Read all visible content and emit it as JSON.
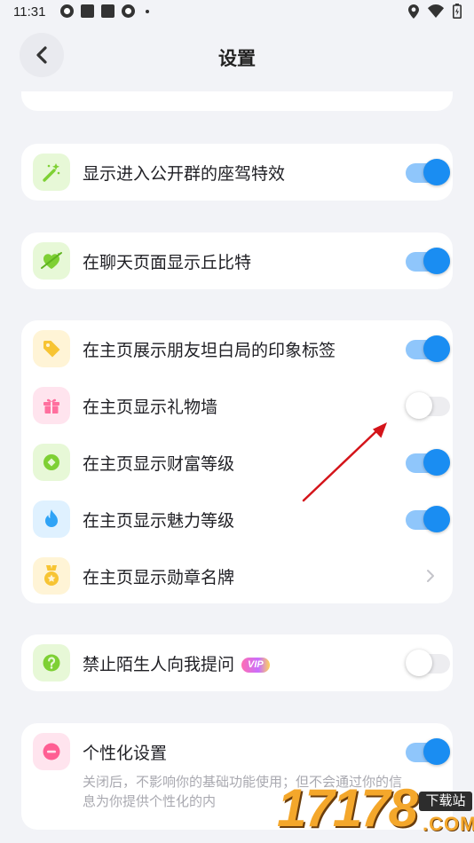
{
  "status_bar": {
    "time": "11:31"
  },
  "header": {
    "title": "设置"
  },
  "cards": {
    "entry": {
      "label": "显示进入公开群的座驾特效",
      "on": true
    },
    "cupid": {
      "label": "在聊天页面显示丘比特",
      "on": true
    },
    "profile": {
      "tags": {
        "label": "在主页展示朋友坦白局的印象标签",
        "on": true
      },
      "gifts": {
        "label": "在主页显示礼物墙",
        "on": false
      },
      "wealth": {
        "label": "在主页显示财富等级",
        "on": true
      },
      "charm": {
        "label": "在主页显示魅力等级",
        "on": true
      },
      "medals": {
        "label": "在主页显示勋章名牌"
      }
    },
    "strangers": {
      "label": "禁止陌生人向我提问",
      "badge": "VIP",
      "on": false
    },
    "personalize": {
      "label": "个性化设置",
      "on": true,
      "description": "关闭后，不影响你的基础功能使用；但不会通过你的信息为你提供个性化的内"
    }
  },
  "watermark": {
    "number": "17178",
    "tag": "下载站",
    "domain": ".COM"
  },
  "colors": {
    "accent": "#1a8df2",
    "background": "#f2f3f7"
  }
}
